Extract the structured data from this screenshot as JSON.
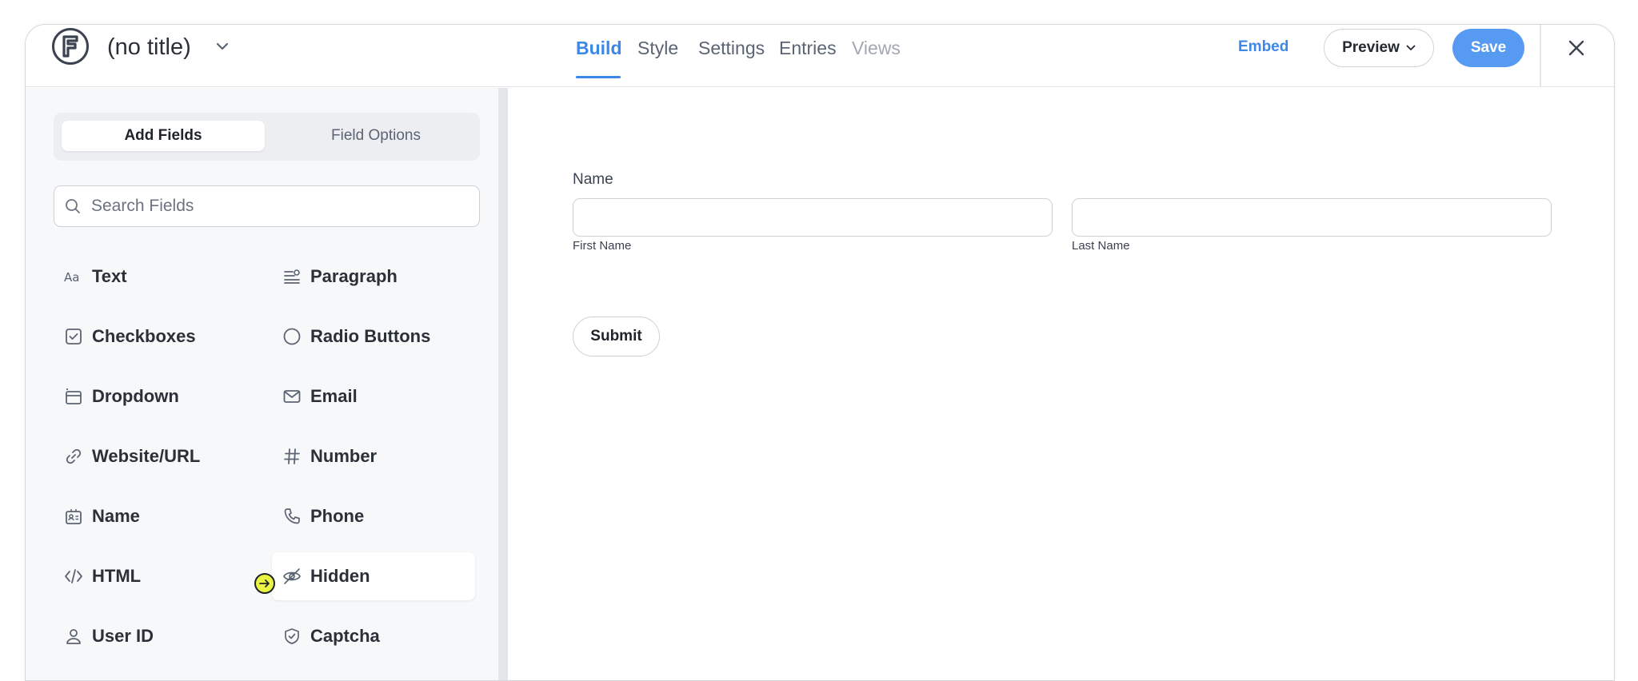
{
  "header": {
    "form_title": "(no title)",
    "tabs": [
      {
        "label": "Build",
        "state": "active"
      },
      {
        "label": "Style",
        "state": "normal"
      },
      {
        "label": "Settings",
        "state": "normal"
      },
      {
        "label": "Entries",
        "state": "normal"
      },
      {
        "label": "Views",
        "state": "disabled"
      }
    ],
    "embed_label": "Embed",
    "preview_label": "Preview",
    "save_label": "Save"
  },
  "sidebar": {
    "segment": {
      "active": "Add Fields",
      "inactive": "Field Options"
    },
    "search_placeholder": "Search Fields",
    "fields": [
      {
        "label": "Text",
        "icon": "text-aa-icon"
      },
      {
        "label": "Paragraph",
        "icon": "paragraph-icon"
      },
      {
        "label": "Checkboxes",
        "icon": "checkbox-icon"
      },
      {
        "label": "Radio Buttons",
        "icon": "radio-icon"
      },
      {
        "label": "Dropdown",
        "icon": "dropdown-icon"
      },
      {
        "label": "Email",
        "icon": "email-icon"
      },
      {
        "label": "Website/URL",
        "icon": "link-icon"
      },
      {
        "label": "Number",
        "icon": "hash-icon"
      },
      {
        "label": "Name",
        "icon": "id-card-icon"
      },
      {
        "label": "Phone",
        "icon": "phone-icon"
      },
      {
        "label": "HTML",
        "icon": "code-icon"
      },
      {
        "label": "Hidden",
        "icon": "eye-off-icon"
      },
      {
        "label": "User ID",
        "icon": "user-icon"
      },
      {
        "label": "Captcha",
        "icon": "shield-icon"
      }
    ]
  },
  "canvas": {
    "name_field_label": "Name",
    "first_name_label": "First Name",
    "last_name_label": "Last Name",
    "submit_label": "Submit"
  },
  "colors": {
    "accent": "#3d87e6",
    "save_button": "#579af1",
    "cursor_highlight": "#e9f542"
  }
}
